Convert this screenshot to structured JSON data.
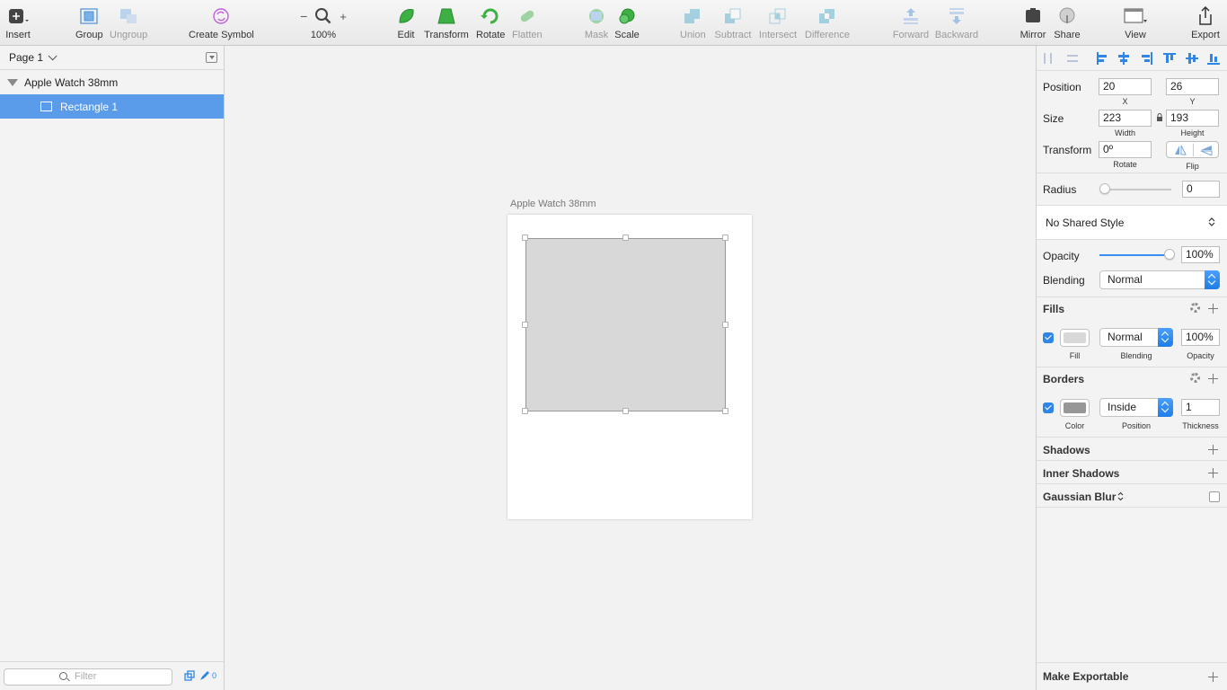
{
  "toolbar": {
    "insert": "Insert",
    "group": "Group",
    "ungroup": "Ungroup",
    "create_symbol": "Create Symbol",
    "zoom_level": "100%",
    "zoom_out": "−",
    "zoom_in": "+",
    "edit": "Edit",
    "transform": "Transform",
    "rotate": "Rotate",
    "flatten": "Flatten",
    "mask": "Mask",
    "scale": "Scale",
    "union": "Union",
    "subtract": "Subtract",
    "intersect": "Intersect",
    "difference": "Difference",
    "forward": "Forward",
    "backward": "Backward",
    "mirror": "Mirror",
    "share": "Share",
    "view": "View",
    "export": "Export"
  },
  "layers": {
    "page": "Page 1",
    "artboard": "Apple Watch 38mm",
    "layer": "Rectangle 1",
    "filter_placeholder": "Filter",
    "count": "0"
  },
  "canvas": {
    "artboard_title": "Apple Watch 38mm"
  },
  "inspector": {
    "position_label": "Position",
    "x": "20",
    "y": "26",
    "x_label": "X",
    "y_label": "Y",
    "size_label": "Size",
    "width": "223",
    "height": "193",
    "width_label": "Width",
    "height_label": "Height",
    "transform_label": "Transform",
    "rotate_value": "0º",
    "rotate_label": "Rotate",
    "flip_label": "Flip",
    "radius_label": "Radius",
    "radius_value": "0",
    "radius_level": 0,
    "shared_style": "No Shared Style",
    "opacity_label": "Opacity",
    "opacity_value": "100%",
    "opacity_level": 1.0,
    "blending_label": "Blending",
    "blending_value": "Normal",
    "fills": {
      "title": "Fills",
      "blending": "Normal",
      "opacity": "100%",
      "fill_label": "Fill",
      "blending_label": "Blending",
      "opacity_label": "Opacity",
      "color": "#d8d8d8"
    },
    "borders": {
      "title": "Borders",
      "position": "Inside",
      "thickness": "1",
      "color_label": "Color",
      "position_label": "Position",
      "thickness_label": "Thickness",
      "color": "#979797"
    },
    "shadows": "Shadows",
    "inner_shadows": "Inner Shadows",
    "gaussian_blur": "Gaussian Blur",
    "make_exportable": "Make Exportable"
  },
  "colors": {
    "accent": "#2f86e6",
    "selection": "#5a9bea"
  }
}
